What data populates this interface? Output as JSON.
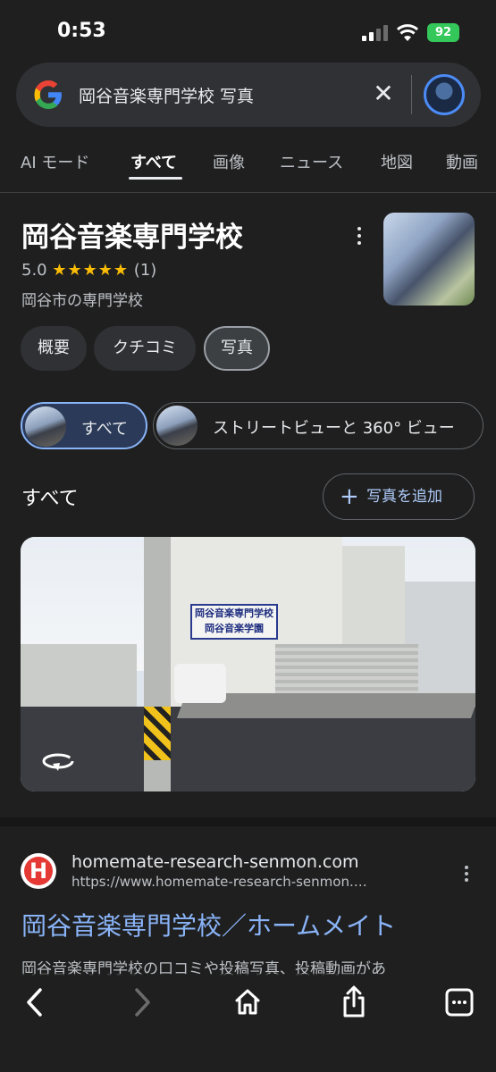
{
  "status": {
    "time": "0:53",
    "battery": "92"
  },
  "search": {
    "query": "岡谷音楽専門学校 写真",
    "clear_label": "✕"
  },
  "tabs": [
    {
      "label": "AI モード"
    },
    {
      "label": "すべて"
    },
    {
      "label": "画像"
    },
    {
      "label": "ニュース"
    },
    {
      "label": "地図"
    },
    {
      "label": "動画"
    }
  ],
  "knowledge_panel": {
    "title": "岡谷音楽専門学校",
    "rating": "5.0",
    "stars": "★★★★★",
    "review_count": "(1)",
    "type": "岡谷市の専門学校",
    "chips": [
      {
        "label": "概要"
      },
      {
        "label": "クチコミ"
      },
      {
        "label": "写真"
      }
    ],
    "photo_filters": [
      {
        "label": "すべて"
      },
      {
        "label": "ストリートビューと 360° ビュー"
      }
    ],
    "section_title": "すべて",
    "add_photo_label": "写真を追加",
    "photo_sign_lines": [
      "岡谷音楽専門学校",
      "岡谷音楽学園"
    ]
  },
  "result": {
    "favicon_letter": "H",
    "site_name": "homemate-research-senmon.com",
    "url": "https://www.homemate-research-senmon.…",
    "title": "岡谷音楽専門学校／ホームメイト",
    "snippet": "岡谷音楽専門学校の口コミや投稿写真、投稿動画があ"
  },
  "colors": {
    "link": "#8ab4f8",
    "star": "#fbbc04",
    "background": "#1f1f1f"
  }
}
